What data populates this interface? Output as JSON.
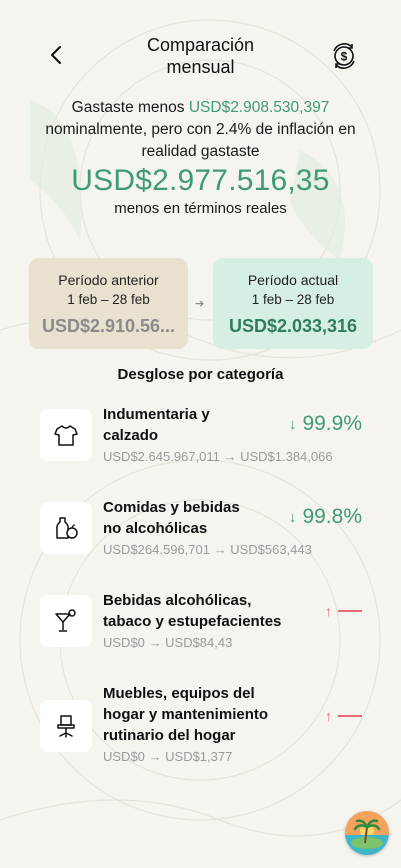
{
  "header": {
    "title_line1": "Comparación",
    "title_line2": "mensual"
  },
  "summary": {
    "prefix": "Gastaste menos ",
    "nominal_amount": "USD$2.908.530,397",
    "line2": "nominalmente, pero con 2.4% de inflación en",
    "line3": "realidad gastaste",
    "real_amount": "USD$2.977.516,35",
    "real_suffix": "menos en términos reales"
  },
  "periods": {
    "previous": {
      "label": "Período anterior",
      "dates": "1 feb – 28 feb",
      "amount": "USD$2.910.56..."
    },
    "current": {
      "label": "Período actual",
      "dates": "1 feb – 28 feb",
      "amount": "USD$2.033,316"
    }
  },
  "breakdown": {
    "title": "Desglose por categoría",
    "categories": [
      {
        "name_line1": "Indumentaria y",
        "name_line2": "calzado",
        "change": "USD$2.645.967,011 → USD$1.384,066",
        "pct": "99.9%",
        "direction": "down",
        "icon": "shirt-icon"
      },
      {
        "name_line1": "Comidas y bebidas",
        "name_line2": "no alcohólicas",
        "change": "USD$264.596,701 → USD$563,443",
        "pct": "99.8%",
        "direction": "down",
        "icon": "food-icon"
      },
      {
        "name_line1": "Bebidas alcohólicas,",
        "name_line2": "tabaco y estupefacientes",
        "change": "USD$0 → USD$84,43",
        "pct": "—",
        "direction": "up",
        "icon": "cocktail-icon"
      },
      {
        "name_line1": "Muebles, equipos del",
        "name_line2": "hogar y mantenimiento",
        "name_line3": "rutinario del hogar",
        "change": "USD$0 → USD$1,377",
        "pct": "—",
        "direction": "up",
        "icon": "chair-icon"
      }
    ]
  },
  "colors": {
    "accent_green": "#3e9b73",
    "increase_red": "#e36b7c",
    "prev_card_bg": "#e9e1d0",
    "current_card_bg": "#d6efe3"
  }
}
